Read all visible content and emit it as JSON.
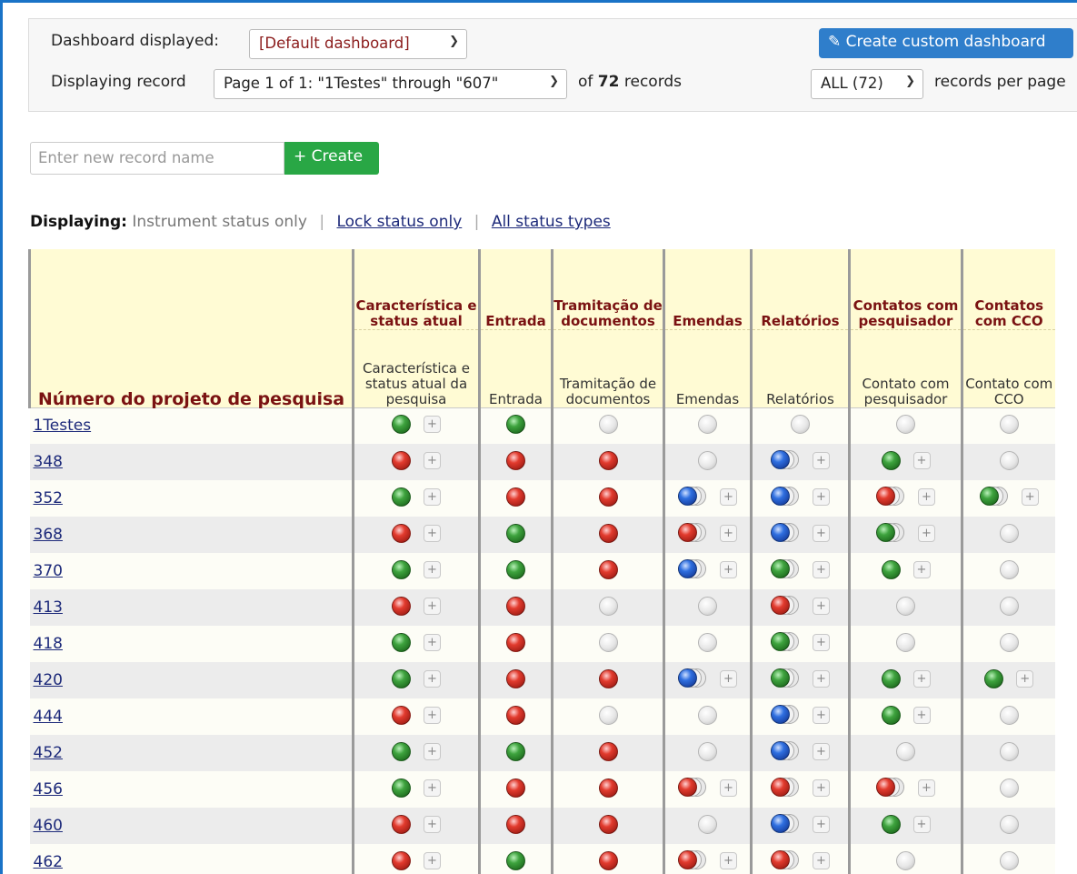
{
  "toolbar": {
    "dashboard_label": "Dashboard displayed:",
    "dashboard_value": "[Default dashboard]",
    "create_dashboard_label": "Create custom dashboard",
    "displaying_label": "Displaying record",
    "page_value": "Page 1 of 1: \"1Testes\" through \"607\"",
    "of_text": "of",
    "records_count": "72",
    "records_text": "records",
    "per_page_value": "ALL (72)",
    "per_page_text": "records per page"
  },
  "create": {
    "placeholder": "Enter new record name",
    "button_label": "+ Create"
  },
  "display": {
    "label": "Displaying:",
    "current": "Instrument status only",
    "lock_link": "Lock status only",
    "all_link": "All status types"
  },
  "table": {
    "record_header": "Número do projeto de pesquisa",
    "columns": [
      {
        "event": "Característica e status atual",
        "form": "Característica e status atual da pesquisa"
      },
      {
        "event": "Entrada",
        "form": "Entrada"
      },
      {
        "event": "Tramitação de documentos",
        "form": "Tramitação de documentos"
      },
      {
        "event": "Emendas",
        "form": "Emendas"
      },
      {
        "event": "Relatórios",
        "form": "Relatórios"
      },
      {
        "event": "Contatos com pesquisador",
        "form": "Contato com pesquisador"
      },
      {
        "event": "Contatos com CCO",
        "form": "Contato com CCO"
      }
    ],
    "rows": [
      {
        "id": "1Testes",
        "cells": [
          [
            "green",
            0,
            1
          ],
          [
            "green",
            0,
            0
          ],
          [
            "gray",
            0,
            0
          ],
          [
            "gray",
            0,
            0
          ],
          [
            "gray",
            0,
            0
          ],
          [
            "gray",
            0,
            0
          ],
          [
            "gray",
            0,
            0
          ]
        ]
      },
      {
        "id": "348",
        "cells": [
          [
            "red",
            0,
            1
          ],
          [
            "red",
            0,
            0
          ],
          [
            "red",
            0,
            0
          ],
          [
            "gray",
            0,
            0
          ],
          [
            "blue",
            1,
            1
          ],
          [
            "green",
            0,
            1
          ],
          [
            "gray",
            0,
            0
          ]
        ]
      },
      {
        "id": "352",
        "cells": [
          [
            "green",
            0,
            1
          ],
          [
            "red",
            0,
            0
          ],
          [
            "red",
            0,
            0
          ],
          [
            "blue",
            1,
            1
          ],
          [
            "blue",
            1,
            1
          ],
          [
            "red",
            1,
            1
          ],
          [
            "green",
            1,
            1
          ]
        ]
      },
      {
        "id": "368",
        "cells": [
          [
            "red",
            0,
            1
          ],
          [
            "green",
            0,
            0
          ],
          [
            "red",
            0,
            0
          ],
          [
            "red",
            1,
            1
          ],
          [
            "blue",
            1,
            1
          ],
          [
            "green",
            1,
            1
          ],
          [
            "gray",
            0,
            0
          ]
        ]
      },
      {
        "id": "370",
        "cells": [
          [
            "green",
            0,
            1
          ],
          [
            "green",
            0,
            0
          ],
          [
            "red",
            0,
            0
          ],
          [
            "blue",
            1,
            1
          ],
          [
            "green",
            1,
            1
          ],
          [
            "green",
            0,
            1
          ],
          [
            "gray",
            0,
            0
          ]
        ]
      },
      {
        "id": "413",
        "cells": [
          [
            "red",
            0,
            1
          ],
          [
            "red",
            0,
            0
          ],
          [
            "gray",
            0,
            0
          ],
          [
            "gray",
            0,
            0
          ],
          [
            "red",
            1,
            1
          ],
          [
            "gray",
            0,
            0
          ],
          [
            "gray",
            0,
            0
          ]
        ]
      },
      {
        "id": "418",
        "cells": [
          [
            "green",
            0,
            1
          ],
          [
            "red",
            0,
            0
          ],
          [
            "gray",
            0,
            0
          ],
          [
            "gray",
            0,
            0
          ],
          [
            "green",
            1,
            1
          ],
          [
            "gray",
            0,
            0
          ],
          [
            "gray",
            0,
            0
          ]
        ]
      },
      {
        "id": "420",
        "cells": [
          [
            "green",
            0,
            1
          ],
          [
            "red",
            0,
            0
          ],
          [
            "red",
            0,
            0
          ],
          [
            "blue",
            1,
            1
          ],
          [
            "green",
            1,
            1
          ],
          [
            "green",
            0,
            1
          ],
          [
            "green",
            0,
            1
          ]
        ]
      },
      {
        "id": "444",
        "cells": [
          [
            "red",
            0,
            1
          ],
          [
            "red",
            0,
            0
          ],
          [
            "gray",
            0,
            0
          ],
          [
            "gray",
            0,
            0
          ],
          [
            "blue",
            1,
            1
          ],
          [
            "green",
            0,
            1
          ],
          [
            "gray",
            0,
            0
          ]
        ]
      },
      {
        "id": "452",
        "cells": [
          [
            "green",
            0,
            1
          ],
          [
            "green",
            0,
            0
          ],
          [
            "red",
            0,
            0
          ],
          [
            "gray",
            0,
            0
          ],
          [
            "blue",
            1,
            1
          ],
          [
            "gray",
            0,
            0
          ],
          [
            "gray",
            0,
            0
          ]
        ]
      },
      {
        "id": "456",
        "cells": [
          [
            "green",
            0,
            1
          ],
          [
            "red",
            0,
            0
          ],
          [
            "red",
            0,
            0
          ],
          [
            "red",
            1,
            1
          ],
          [
            "red",
            1,
            1
          ],
          [
            "red",
            1,
            1
          ],
          [
            "gray",
            0,
            0
          ]
        ]
      },
      {
        "id": "460",
        "cells": [
          [
            "red",
            0,
            1
          ],
          [
            "red",
            0,
            0
          ],
          [
            "red",
            0,
            0
          ],
          [
            "gray",
            0,
            0
          ],
          [
            "blue",
            1,
            1
          ],
          [
            "green",
            0,
            1
          ],
          [
            "gray",
            0,
            0
          ]
        ]
      },
      {
        "id": "462",
        "cells": [
          [
            "red",
            0,
            1
          ],
          [
            "green",
            0,
            0
          ],
          [
            "red",
            0,
            0
          ],
          [
            "red",
            1,
            1
          ],
          [
            "red",
            1,
            1
          ],
          [
            "gray",
            0,
            0
          ],
          [
            "gray",
            0,
            0
          ]
        ]
      }
    ]
  },
  "colors": {
    "accent_blue": "#2f7ecb",
    "create_green": "#29a745",
    "header_bg": "#fffbd4",
    "header_text": "#7a1212",
    "link": "#1d2a7a"
  }
}
